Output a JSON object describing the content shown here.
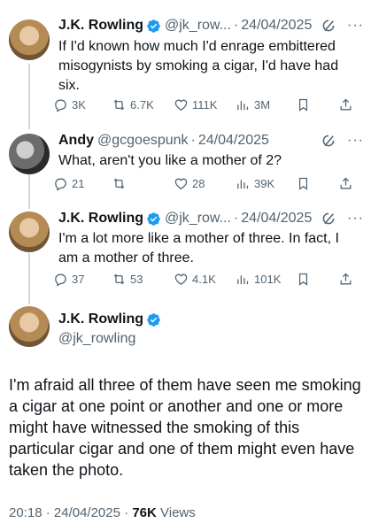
{
  "tweets": [
    {
      "name": "J.K. Rowling",
      "handle": "@jk_row...",
      "date": "24/04/2025",
      "text": "If I'd known how much I'd enrage embittered misogynists by smoking a cigar, I'd have had six.",
      "replies": "3K",
      "retweets": "6.7K",
      "likes": "111K",
      "views": "3M"
    },
    {
      "name": "Andy",
      "handle": "@gcgoespunk",
      "date": "24/04/2025",
      "text": "What, aren't you like a mother of 2?",
      "replies": "21",
      "retweets": "",
      "likes": "28",
      "views": "39K"
    },
    {
      "name": "J.K. Rowling",
      "handle": "@jk_row...",
      "date": "24/04/2025",
      "text": "I'm a lot more like a mother of three. In fact, I am a mother of three.",
      "replies": "37",
      "retweets": "53",
      "likes": "4.1K",
      "views": "101K"
    }
  ],
  "main": {
    "name": "J.K. Rowling",
    "handle": "@jk_rowling",
    "text": "I'm afraid all three of them have seen me smoking a cigar at one point or another and one or more might have witnessed the smoking of this particular cigar and one of them might even have taken the photo.",
    "time": "20:18",
    "date": "24/04/2025",
    "views_count": "76K",
    "views_label": "Views"
  },
  "separator": "·",
  "more_glyph": "···",
  "colors": {
    "verified": "#1d9bf0",
    "muted": "#536471",
    "text": "#0f1419",
    "line": "#cfd9de"
  }
}
